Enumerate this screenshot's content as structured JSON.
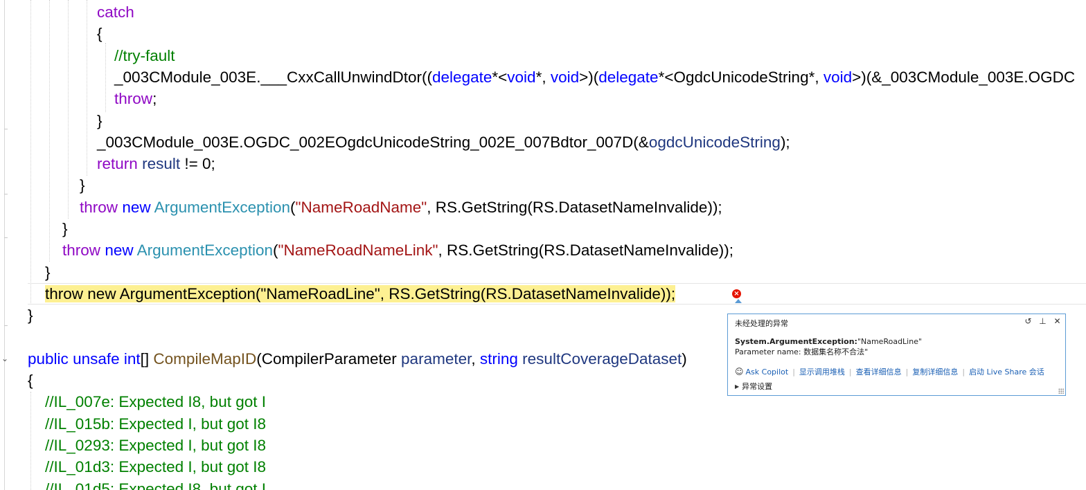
{
  "editor": {
    "code_lines": [
      {
        "indent": "            ",
        "tokens": [
          {
            "c": "ctl",
            "t": "catch"
          }
        ]
      },
      {
        "indent": "            ",
        "tokens": [
          {
            "c": "",
            "t": "{"
          }
        ]
      },
      {
        "indent": "                ",
        "tokens": [
          {
            "c": "cmt",
            "t": "//try-fault"
          }
        ]
      },
      {
        "indent": "                ",
        "tokens": [
          {
            "c": "",
            "t": "_003CModule_003E.___CxxCallUnwindDtor(("
          },
          {
            "c": "kw",
            "t": "delegate"
          },
          {
            "c": "",
            "t": "*<"
          },
          {
            "c": "kw",
            "t": "void"
          },
          {
            "c": "",
            "t": "*, "
          },
          {
            "c": "kw",
            "t": "void"
          },
          {
            "c": "",
            "t": ">)("
          },
          {
            "c": "kw",
            "t": "delegate"
          },
          {
            "c": "",
            "t": "*<OgdcUnicodeString*, "
          },
          {
            "c": "kw",
            "t": "void"
          },
          {
            "c": "",
            "t": ">)(&_003CModule_003E.OGDC"
          }
        ]
      },
      {
        "indent": "                ",
        "tokens": [
          {
            "c": "ctl",
            "t": "throw"
          },
          {
            "c": "",
            "t": ";"
          }
        ]
      },
      {
        "indent": "            ",
        "tokens": [
          {
            "c": "",
            "t": "}"
          }
        ]
      },
      {
        "indent": "            ",
        "tokens": [
          {
            "c": "",
            "t": "_003CModule_003E.OGDC_002EOgdcUnicodeString_002E_007Bdtor_007D(&"
          },
          {
            "c": "param",
            "t": "ogdcUnicodeString"
          },
          {
            "c": "",
            "t": ");"
          }
        ]
      },
      {
        "indent": "            ",
        "tokens": [
          {
            "c": "ctl",
            "t": "return"
          },
          {
            "c": "",
            "t": " "
          },
          {
            "c": "param",
            "t": "result"
          },
          {
            "c": "",
            "t": " != 0;"
          }
        ]
      },
      {
        "indent": "        ",
        "tokens": [
          {
            "c": "",
            "t": "}"
          }
        ]
      },
      {
        "indent": "        ",
        "tokens": [
          {
            "c": "ctl",
            "t": "throw"
          },
          {
            "c": "",
            "t": " "
          },
          {
            "c": "kw",
            "t": "new"
          },
          {
            "c": "",
            "t": " "
          },
          {
            "c": "type",
            "t": "ArgumentException"
          },
          {
            "c": "",
            "t": "("
          },
          {
            "c": "str",
            "t": "\"NameRoadName\""
          },
          {
            "c": "",
            "t": ", RS.GetString(RS.DatasetNameInvalide));"
          }
        ]
      },
      {
        "indent": "    ",
        "tokens": [
          {
            "c": "",
            "t": "}"
          }
        ]
      },
      {
        "indent": "    ",
        "tokens": [
          {
            "c": "ctl",
            "t": "throw"
          },
          {
            "c": "",
            "t": " "
          },
          {
            "c": "kw",
            "t": "new"
          },
          {
            "c": "",
            "t": " "
          },
          {
            "c": "type",
            "t": "ArgumentException"
          },
          {
            "c": "",
            "t": "("
          },
          {
            "c": "str",
            "t": "\"NameRoadNameLink\""
          },
          {
            "c": "",
            "t": ", RS.GetString(RS.DatasetNameInvalide));"
          }
        ]
      },
      {
        "indent": "",
        "tokens": [
          {
            "c": "",
            "t": "}"
          }
        ]
      },
      {
        "indent": "",
        "highlight": true,
        "tokens": [
          {
            "c": "",
            "t": "throw new ArgumentException(\"NameRoadLine\", RS.GetString(RS.DatasetNameInvalide));"
          }
        ]
      },
      {
        "indent": "",
        "tokens": [
          {
            "c": "",
            "t": "}"
          }
        ]
      },
      {
        "indent": "",
        "tokens": []
      },
      {
        "indent": "",
        "tokens": [
          {
            "c": "kw",
            "t": "public"
          },
          {
            "c": "",
            "t": " "
          },
          {
            "c": "kw",
            "t": "unsafe"
          },
          {
            "c": "",
            "t": " "
          },
          {
            "c": "kw",
            "t": "int"
          },
          {
            "c": "",
            "t": "[] "
          },
          {
            "c": "meth",
            "t": "CompileMapID"
          },
          {
            "c": "",
            "t": "(CompilerParameter "
          },
          {
            "c": "param",
            "t": "parameter"
          },
          {
            "c": "",
            "t": ", "
          },
          {
            "c": "kw",
            "t": "string"
          },
          {
            "c": "",
            "t": " "
          },
          {
            "c": "param",
            "t": "resultCoverageDataset"
          },
          {
            "c": "",
            "t": ")"
          }
        ]
      },
      {
        "indent": "",
        "tokens": [
          {
            "c": "",
            "t": "{"
          }
        ]
      },
      {
        "indent": "",
        "tokens": [
          {
            "c": "cmt",
            "t": "//IL_007e: Expected I8, but got I"
          }
        ]
      },
      {
        "indent": "",
        "tokens": [
          {
            "c": "cmt",
            "t": "//IL_015b: Expected I, but got I8"
          }
        ]
      },
      {
        "indent": "",
        "tokens": [
          {
            "c": "cmt",
            "t": "//IL_0293: Expected I, but got I8"
          }
        ]
      },
      {
        "indent": "",
        "tokens": [
          {
            "c": "cmt",
            "t": "//IL_01d3: Expected I, but got I8"
          }
        ]
      },
      {
        "indent": "",
        "tokens": [
          {
            "c": "cmt",
            "t": "//IL_01d5: Expected I8, but got I"
          }
        ]
      }
    ]
  },
  "exception_popup": {
    "title": "未经处理的异常",
    "exception_type": "System.ArgumentException:",
    "exception_message": "\"NameRoadLine\"",
    "parameter_line": "Parameter name: 数据集名称不合法\"",
    "links": {
      "ask_copilot": "Ask Copilot",
      "call_stack": "显示调用堆栈",
      "view_details": "查看详细信息",
      "copy_details": "复制详细信息",
      "live_share": "启动 Live Share 会话"
    },
    "settings_label": "异常设置",
    "icons": {
      "history": "history-icon",
      "pin": "pin-icon",
      "close": "close-icon",
      "copilot": "copilot-icon"
    }
  },
  "colors": {
    "keyword": "#0000ff",
    "control": "#8f08c4",
    "type": "#2b91af",
    "string": "#a31515",
    "comment": "#008000",
    "parameter": "#1f377f",
    "method": "#74531f",
    "highlight": "#fdf092",
    "error": "#e51400",
    "popup_border": "#5b9bd5"
  }
}
